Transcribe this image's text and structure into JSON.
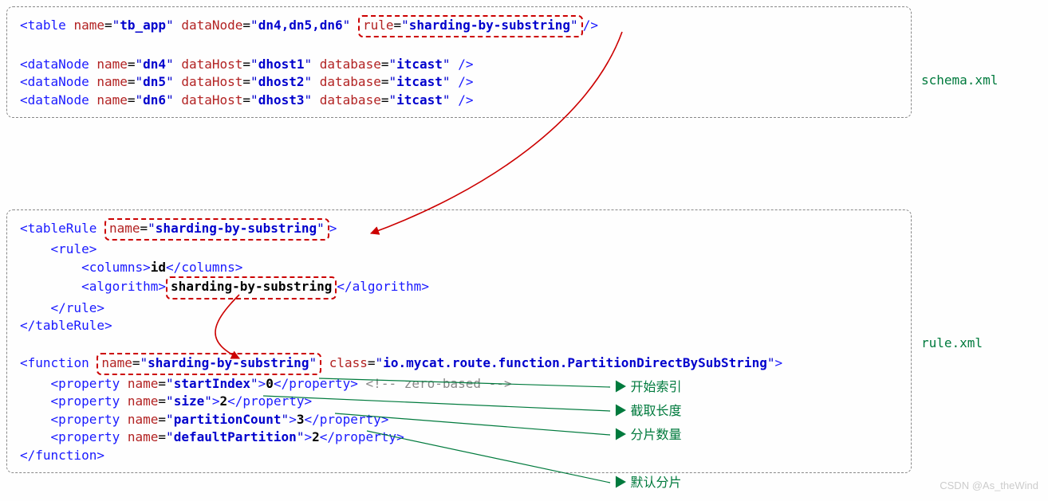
{
  "labels": {
    "schema_file": "schema.xml",
    "rule_file": "rule.xml",
    "watermark": "CSDN @As_theWind"
  },
  "schema": {
    "table": {
      "tag": "table",
      "name": "tb_app",
      "dataNode": "dn4,dn5,dn6",
      "rule_attr": "rule",
      "rule_val": "sharding-by-substring"
    },
    "dataNodes": [
      {
        "name": "dn4",
        "dataHost": "dhost1",
        "database": "itcast"
      },
      {
        "name": "dn5",
        "dataHost": "dhost2",
        "database": "itcast"
      },
      {
        "name": "dn6",
        "dataHost": "dhost3",
        "database": "itcast"
      }
    ],
    "dn_tag": "dataNode",
    "attrs": {
      "name": "name",
      "dataNode": "dataNode",
      "dataHost": "dataHost",
      "database": "database"
    }
  },
  "rule": {
    "tableRule": {
      "tag": "tableRule",
      "name_attr": "name",
      "name_val": "sharding-by-substring",
      "rule_tag": "rule",
      "columns_tag": "columns",
      "columns_val": "id",
      "algorithm_tag": "algorithm",
      "algorithm_val": "sharding-by-substring"
    },
    "function": {
      "tag": "function",
      "name_attr": "name",
      "name_val": "sharding-by-substring",
      "class_attr": "class",
      "class_val": "io.mycat.route.function.PartitionDirectBySubString",
      "prop_tag": "property",
      "props": [
        {
          "name": "startIndex",
          "value": "0",
          "comment": "<!-- zero-based -->",
          "label": "开始索引"
        },
        {
          "name": "size",
          "value": "2",
          "label": "截取长度"
        },
        {
          "name": "partitionCount",
          "value": "3",
          "label": "分片数量"
        },
        {
          "name": "defaultPartition",
          "value": "2",
          "label": "默认分片"
        }
      ]
    }
  }
}
